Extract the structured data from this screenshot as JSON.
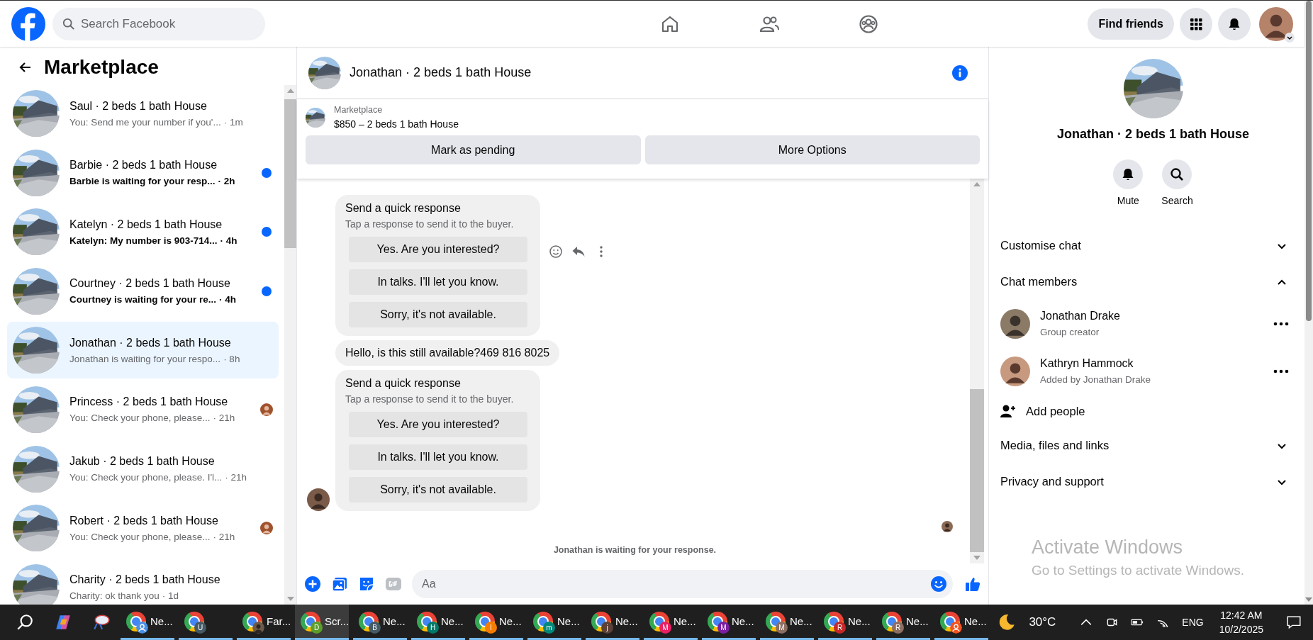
{
  "top_bar": {
    "search": {
      "placeholder": "Search Facebook"
    },
    "find_friends": "Find friends"
  },
  "sidebar": {
    "title": "Marketplace",
    "conversations": [
      {
        "name": "Saul · 2 beds 1 bath House",
        "preview": "You: Send me your number if you'...",
        "time": "· 1m",
        "unread": false,
        "selected": false,
        "read_receipt": false
      },
      {
        "name": "Barbie · 2 beds 1 bath House",
        "preview": "Barbie is waiting for your resp...",
        "time": "· 2h",
        "unread": true,
        "selected": false,
        "read_receipt": false
      },
      {
        "name": "Katelyn · 2 beds 1 bath House",
        "preview": "Katelyn: My number is 903-714...",
        "time": "· 4h",
        "unread": true,
        "selected": false,
        "read_receipt": false
      },
      {
        "name": "Courtney · 2 beds 1 bath House",
        "preview": "Courtney is waiting for your re...",
        "time": "· 4h",
        "unread": true,
        "selected": false,
        "read_receipt": false
      },
      {
        "name": "Jonathan · 2 beds 1 bath House",
        "preview": "Jonathan is waiting for your respo...",
        "time": "· 8h",
        "unread": false,
        "selected": true,
        "read_receipt": false
      },
      {
        "name": "Princess · 2 beds 1 bath House",
        "preview": "You: Check your phone, please...",
        "time": "· 21h",
        "unread": false,
        "selected": false,
        "read_receipt": true
      },
      {
        "name": "Jakub · 2 beds 1 bath House",
        "preview": "You: Check your phone, please. I'l...",
        "time": "· 21h",
        "unread": false,
        "selected": false,
        "read_receipt": false
      },
      {
        "name": "Robert · 2 beds 1 bath House",
        "preview": "You: Check your phone, please...",
        "time": "· 21h",
        "unread": false,
        "selected": false,
        "read_receipt": true
      },
      {
        "name": "Charity · 2 beds 1 bath House",
        "preview": "Charity: ok thank you",
        "time": "· 1d",
        "unread": false,
        "selected": false,
        "read_receipt": false
      }
    ]
  },
  "chat": {
    "title": "Jonathan · 2 beds 1 bath House",
    "listing": {
      "label": "Marketplace",
      "title": "$850 – 2 beds 1 bath House",
      "actions": [
        "Mark as pending",
        "More Options"
      ]
    },
    "messages": [
      {
        "kind": "quick_response",
        "title": "Send a quick response",
        "subtitle": "Tap a response to send it to the buyer.",
        "options": [
          "Yes. Are you interested?",
          "In talks. I'll let you know.",
          "Sorry, it's not available."
        ],
        "avatar": false,
        "actions": true
      },
      {
        "kind": "text",
        "text": "Hello, is this still available?469 816 8025",
        "avatar": false,
        "actions": false
      },
      {
        "kind": "quick_response",
        "title": "Send a quick response",
        "subtitle": "Tap a response to send it to the buyer.",
        "options": [
          "Yes. Are you interested?",
          "In talks. I'll let you know.",
          "Sorry, it's not available."
        ],
        "avatar": true,
        "actions": false
      }
    ],
    "status": "Jonathan is waiting for your response.",
    "composer": {
      "placeholder": "Aa"
    }
  },
  "details": {
    "title": "Jonathan · 2 beds 1 bath House",
    "actions": [
      {
        "kind": "mute",
        "label": "Mute"
      },
      {
        "kind": "search",
        "label": "Search"
      }
    ],
    "sections": [
      {
        "label": "Customise chat",
        "expanded": false
      },
      {
        "label": "Chat members",
        "expanded": true,
        "members": [
          {
            "name": "Jonathan Drake",
            "role": "Group creator"
          },
          {
            "name": "Kathryn Hammock",
            "role": "Added by Jonathan Drake"
          }
        ],
        "add_label": "Add people"
      },
      {
        "label": "Media, files and links",
        "expanded": false
      },
      {
        "label": "Privacy and support",
        "expanded": false
      }
    ]
  },
  "watermark": {
    "title": "Activate Windows",
    "text": "Go to Settings to activate Windows."
  },
  "taskbar": {
    "apps": [
      {
        "label": "Ne...",
        "kind": "person",
        "color": "#4a8fe7",
        "selected": false
      },
      {
        "kind": "letter",
        "badge": "U",
        "color": "#455a64",
        "selected": false
      },
      {
        "label": "Far...",
        "color": "#6d5a4a",
        "selected": false
      },
      {
        "label": "Scr...",
        "kind": "letter",
        "badge": "D",
        "color": "#5c9e2c",
        "selected": true
      },
      {
        "label": "Ne...",
        "kind": "letter",
        "badge": "B",
        "color": "#455a64",
        "selected": false
      },
      {
        "label": "Ne...",
        "kind": "letter",
        "badge": "H",
        "color": "#00796b",
        "selected": false
      },
      {
        "label": "Ne...",
        "kind": "letter",
        "badge": "I",
        "color": "#f57c00",
        "selected": false
      },
      {
        "label": "Ne...",
        "kind": "letter",
        "badge": "m",
        "color": "#00897b",
        "selected": false
      },
      {
        "label": "Ne...",
        "kind": "letter",
        "badge": "j",
        "color": "#5d4037",
        "selected": false
      },
      {
        "label": "Ne...",
        "kind": "letter",
        "badge": "M",
        "color": "#e91e63",
        "selected": false
      },
      {
        "label": "Ne...",
        "kind": "letter",
        "badge": "M",
        "color": "#7b1fa2",
        "selected": false
      },
      {
        "label": "Ne...",
        "kind": "letter",
        "badge": "M",
        "color": "#8d6e63",
        "selected": false
      },
      {
        "label": "Ne...",
        "kind": "letter",
        "badge": "R",
        "color": "#c62828",
        "selected": false
      },
      {
        "label": "Ne...",
        "kind": "letter",
        "badge": "R",
        "color": "#8d6e63",
        "selected": false
      },
      {
        "label": "Ne...",
        "kind": "person",
        "color": "#f4511e",
        "selected": false
      }
    ],
    "weather": "30°C",
    "language": "ENG",
    "time": "12:42 AM",
    "date": "10/2/2025"
  }
}
